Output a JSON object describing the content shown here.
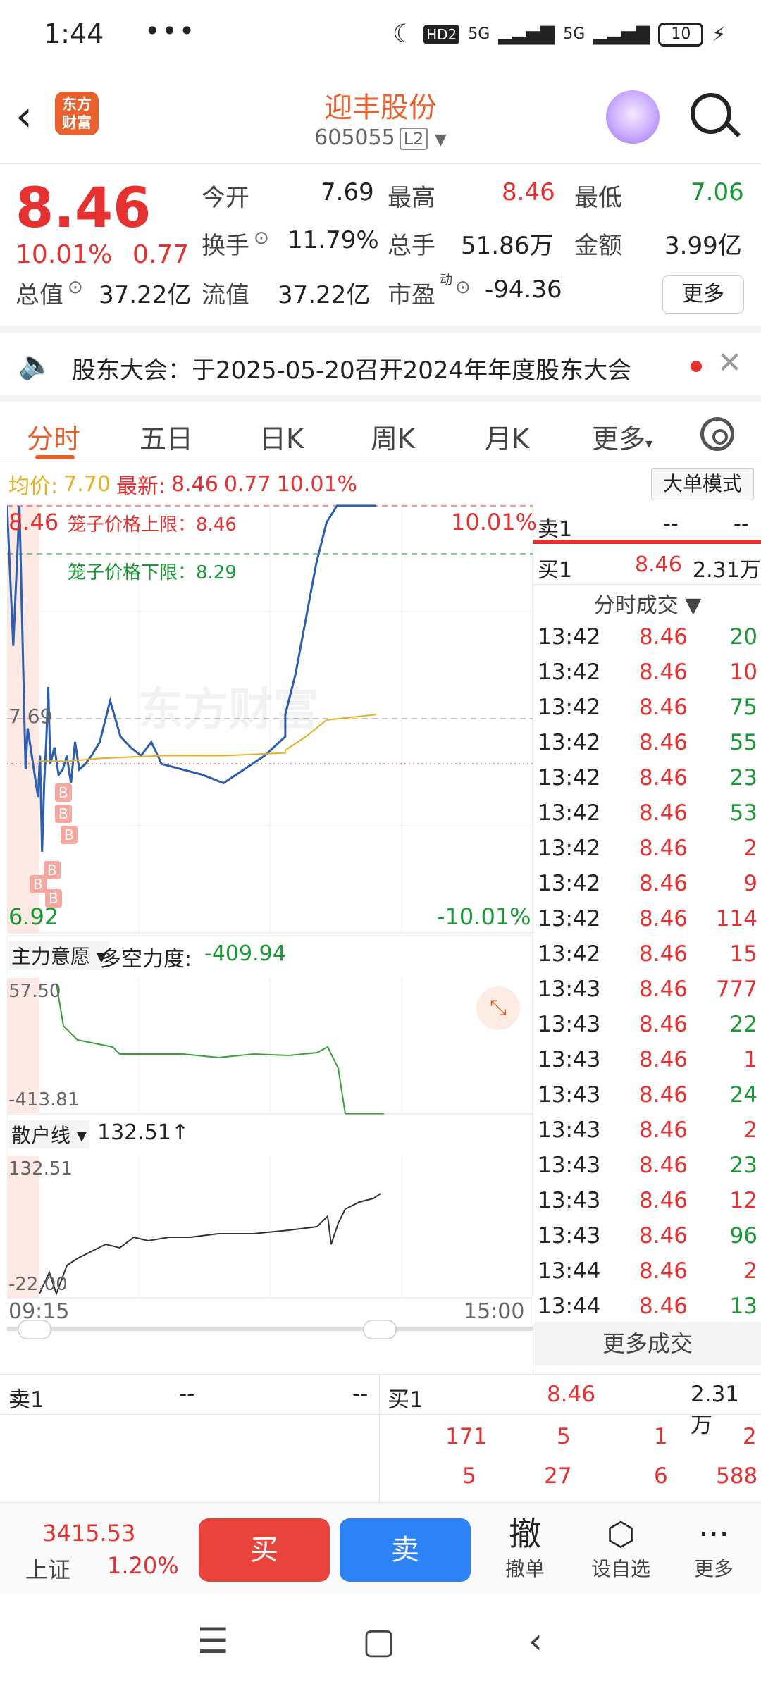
{
  "status": {
    "time": "1:44",
    "dots": "•••",
    "network1": "5G",
    "network2": "5G",
    "hd": "HD2",
    "battery": "10"
  },
  "header": {
    "title": "迎丰股份",
    "code": "605055",
    "level": "L2",
    "logo_line1": "东方",
    "logo_line2": "财富"
  },
  "quote": {
    "price": "8.46",
    "change_pct": "10.01%",
    "change": "0.77",
    "open_label": "今开",
    "open": "7.69",
    "high_label": "最高",
    "high": "8.46",
    "low_label": "最低",
    "low": "7.06",
    "turnover_label": "换手",
    "turnover": "11.79%",
    "volume_label": "总手",
    "volume": "51.86万",
    "amount_label": "金额",
    "amount": "3.99亿",
    "mcap_label": "总值",
    "mcap": "37.22亿",
    "float_label": "流值",
    "float": "37.22亿",
    "pe_label": "市盈",
    "pe_sup": "动",
    "pe": "-94.36",
    "more_label": "更多"
  },
  "notice": {
    "text": "股东大会：于2025-05-20召开2024年年度股东大会"
  },
  "tabs": [
    "分时",
    "五日",
    "日K",
    "周K",
    "月K",
    "更多"
  ],
  "inforow": {
    "avg_label": "均价:",
    "avg": "7.70",
    "last_label": "最新:",
    "last": "8.46",
    "chg": "0.77",
    "pct": "10.01%",
    "bigmode": "大单模式"
  },
  "chart": {
    "top_price": "8.46",
    "top_pct": "10.01%",
    "open_line": "7.69",
    "bottom_price": "6.92",
    "bottom_pct": "-10.01%",
    "cage_upper": "笼子价格上限：8.46",
    "cage_lower": "笼子价格下限：8.29",
    "watermark": "东方财富",
    "ind1_name": "主力意愿",
    "ind1_label": "多空力度:",
    "ind1_value": "-409.94",
    "ind1_max": "57.50",
    "ind1_min": "-413.81",
    "ind2_name": "散户线",
    "ind2_value": "132.51↑",
    "ind2_max": "132.51",
    "ind2_min": "-22.00",
    "time_start": "09:15",
    "time_end": "15:00",
    "marker": "B"
  },
  "chart_data": {
    "type": "line",
    "title": "",
    "xlabel": "",
    "ylabel": "",
    "x_range": [
      "09:15",
      "15:00"
    ],
    "ylim": [
      6.92,
      8.46
    ],
    "series": [
      {
        "name": "",
        "color": "#2c5fb0",
        "x": [
          "09:15",
          "09:18",
          "09:21",
          "09:24",
          "09:25",
          "09:30",
          "09:31",
          "09:32",
          "09:33",
          "09:34",
          "09:35",
          "09:36",
          "09:38",
          "09:40",
          "09:42",
          "09:44",
          "09:46",
          "09:48",
          "09:50",
          "09:53",
          "09:56",
          "10:00",
          "10:05",
          "10:10",
          "10:15",
          "10:20",
          "10:25",
          "10:30",
          "10:40",
          "10:50",
          "11:00",
          "11:10",
          "11:20",
          "11:30",
          "13:00",
          "13:05",
          "13:10",
          "13:15",
          "13:20",
          "13:25",
          "13:30",
          "13:35",
          "13:40",
          "13:44"
        ],
        "values": [
          8.46,
          7.95,
          8.46,
          7.5,
          7.65,
          7.4,
          7.55,
          7.2,
          7.45,
          7.6,
          7.8,
          7.52,
          7.58,
          7.48,
          7.5,
          7.55,
          7.45,
          7.6,
          7.5,
          7.52,
          7.55,
          7.6,
          7.75,
          7.62,
          7.58,
          7.55,
          7.6,
          7.52,
          7.5,
          7.48,
          7.45,
          7.5,
          7.55,
          7.62,
          7.7,
          7.85,
          8.05,
          8.25,
          8.4,
          8.46,
          8.46,
          8.46,
          8.46,
          8.46
        ]
      },
      {
        "name": "",
        "color": "#e8b020",
        "x": [
          "09:30",
          "09:45",
          "10:00",
          "10:30",
          "11:00",
          "11:30",
          "13:00",
          "13:10",
          "13:20",
          "13:44"
        ],
        "values": [
          7.53,
          7.53,
          7.54,
          7.55,
          7.55,
          7.56,
          7.57,
          7.62,
          7.68,
          7.7
        ]
      }
    ]
  },
  "orderbook": {
    "sell1_label": "卖1",
    "sell1_price": "--",
    "sell1_vol": "--",
    "buy1_label": "买1",
    "buy1_price": "8.46",
    "buy1_vol": "2.31万"
  },
  "ticks_header": "分时成交",
  "ticks": [
    {
      "t": "13:42",
      "p": "8.46",
      "v": "20",
      "c": "#1a9a35"
    },
    {
      "t": "13:42",
      "p": "8.46",
      "v": "10",
      "c": "#e5312f"
    },
    {
      "t": "13:42",
      "p": "8.46",
      "v": "75",
      "c": "#1a9a35"
    },
    {
      "t": "13:42",
      "p": "8.46",
      "v": "55",
      "c": "#1a9a35"
    },
    {
      "t": "13:42",
      "p": "8.46",
      "v": "23",
      "c": "#1a9a35"
    },
    {
      "t": "13:42",
      "p": "8.46",
      "v": "53",
      "c": "#1a9a35"
    },
    {
      "t": "13:42",
      "p": "8.46",
      "v": "2",
      "c": "#e5312f"
    },
    {
      "t": "13:42",
      "p": "8.46",
      "v": "9",
      "c": "#e5312f"
    },
    {
      "t": "13:42",
      "p": "8.46",
      "v": "114",
      "c": "#e5312f"
    },
    {
      "t": "13:42",
      "p": "8.46",
      "v": "15",
      "c": "#e5312f"
    },
    {
      "t": "13:43",
      "p": "8.46",
      "v": "777",
      "c": "#e5312f"
    },
    {
      "t": "13:43",
      "p": "8.46",
      "v": "22",
      "c": "#1a9a35"
    },
    {
      "t": "13:43",
      "p": "8.46",
      "v": "1",
      "c": "#e5312f"
    },
    {
      "t": "13:43",
      "p": "8.46",
      "v": "24",
      "c": "#1a9a35"
    },
    {
      "t": "13:43",
      "p": "8.46",
      "v": "2",
      "c": "#e5312f"
    },
    {
      "t": "13:43",
      "p": "8.46",
      "v": "23",
      "c": "#1a9a35"
    },
    {
      "t": "13:43",
      "p": "8.46",
      "v": "12",
      "c": "#e5312f"
    },
    {
      "t": "13:43",
      "p": "8.46",
      "v": "96",
      "c": "#1a9a35"
    },
    {
      "t": "13:44",
      "p": "8.46",
      "v": "2",
      "c": "#e5312f"
    },
    {
      "t": "13:44",
      "p": "8.46",
      "v": "13",
      "c": "#1a9a35"
    }
  ],
  "more_trades": "更多成交",
  "bottombook": {
    "sell1_label": "卖1",
    "sell1_price": "--",
    "sell1_vol": "--",
    "buy1_label": "买1",
    "buy1_price": "8.46",
    "buy1_vol": "2.31万",
    "row1": [
      "171",
      "5",
      "1",
      "2"
    ],
    "row2": [
      "5",
      "27",
      "6",
      "588"
    ]
  },
  "toolbar": {
    "index_value": "3415.53",
    "index_name": "上证",
    "index_pct": "1.20%",
    "buy": "买",
    "sell": "卖",
    "cancel_icon": "撤",
    "cancel_label": "撤单",
    "watch_label": "设自选",
    "more_label": "更多"
  }
}
